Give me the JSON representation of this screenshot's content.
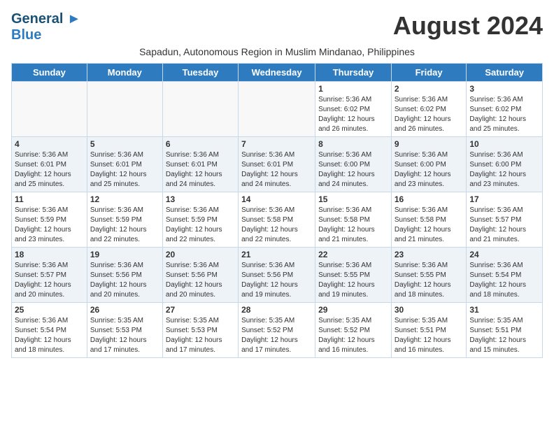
{
  "logo": {
    "line1": "General",
    "line2": "Blue"
  },
  "title": "August 2024",
  "subtitle": "Sapadun, Autonomous Region in Muslim Mindanao, Philippines",
  "weekdays": [
    "Sunday",
    "Monday",
    "Tuesday",
    "Wednesday",
    "Thursday",
    "Friday",
    "Saturday"
  ],
  "weeks": [
    [
      {
        "day": "",
        "info": ""
      },
      {
        "day": "",
        "info": ""
      },
      {
        "day": "",
        "info": ""
      },
      {
        "day": "",
        "info": ""
      },
      {
        "day": "1",
        "info": "Sunrise: 5:36 AM\nSunset: 6:02 PM\nDaylight: 12 hours\nand 26 minutes."
      },
      {
        "day": "2",
        "info": "Sunrise: 5:36 AM\nSunset: 6:02 PM\nDaylight: 12 hours\nand 26 minutes."
      },
      {
        "day": "3",
        "info": "Sunrise: 5:36 AM\nSunset: 6:02 PM\nDaylight: 12 hours\nand 25 minutes."
      }
    ],
    [
      {
        "day": "4",
        "info": "Sunrise: 5:36 AM\nSunset: 6:01 PM\nDaylight: 12 hours\nand 25 minutes."
      },
      {
        "day": "5",
        "info": "Sunrise: 5:36 AM\nSunset: 6:01 PM\nDaylight: 12 hours\nand 25 minutes."
      },
      {
        "day": "6",
        "info": "Sunrise: 5:36 AM\nSunset: 6:01 PM\nDaylight: 12 hours\nand 24 minutes."
      },
      {
        "day": "7",
        "info": "Sunrise: 5:36 AM\nSunset: 6:01 PM\nDaylight: 12 hours\nand 24 minutes."
      },
      {
        "day": "8",
        "info": "Sunrise: 5:36 AM\nSunset: 6:00 PM\nDaylight: 12 hours\nand 24 minutes."
      },
      {
        "day": "9",
        "info": "Sunrise: 5:36 AM\nSunset: 6:00 PM\nDaylight: 12 hours\nand 23 minutes."
      },
      {
        "day": "10",
        "info": "Sunrise: 5:36 AM\nSunset: 6:00 PM\nDaylight: 12 hours\nand 23 minutes."
      }
    ],
    [
      {
        "day": "11",
        "info": "Sunrise: 5:36 AM\nSunset: 5:59 PM\nDaylight: 12 hours\nand 23 minutes."
      },
      {
        "day": "12",
        "info": "Sunrise: 5:36 AM\nSunset: 5:59 PM\nDaylight: 12 hours\nand 22 minutes."
      },
      {
        "day": "13",
        "info": "Sunrise: 5:36 AM\nSunset: 5:59 PM\nDaylight: 12 hours\nand 22 minutes."
      },
      {
        "day": "14",
        "info": "Sunrise: 5:36 AM\nSunset: 5:58 PM\nDaylight: 12 hours\nand 22 minutes."
      },
      {
        "day": "15",
        "info": "Sunrise: 5:36 AM\nSunset: 5:58 PM\nDaylight: 12 hours\nand 21 minutes."
      },
      {
        "day": "16",
        "info": "Sunrise: 5:36 AM\nSunset: 5:58 PM\nDaylight: 12 hours\nand 21 minutes."
      },
      {
        "day": "17",
        "info": "Sunrise: 5:36 AM\nSunset: 5:57 PM\nDaylight: 12 hours\nand 21 minutes."
      }
    ],
    [
      {
        "day": "18",
        "info": "Sunrise: 5:36 AM\nSunset: 5:57 PM\nDaylight: 12 hours\nand 20 minutes."
      },
      {
        "day": "19",
        "info": "Sunrise: 5:36 AM\nSunset: 5:56 PM\nDaylight: 12 hours\nand 20 minutes."
      },
      {
        "day": "20",
        "info": "Sunrise: 5:36 AM\nSunset: 5:56 PM\nDaylight: 12 hours\nand 20 minutes."
      },
      {
        "day": "21",
        "info": "Sunrise: 5:36 AM\nSunset: 5:56 PM\nDaylight: 12 hours\nand 19 minutes."
      },
      {
        "day": "22",
        "info": "Sunrise: 5:36 AM\nSunset: 5:55 PM\nDaylight: 12 hours\nand 19 minutes."
      },
      {
        "day": "23",
        "info": "Sunrise: 5:36 AM\nSunset: 5:55 PM\nDaylight: 12 hours\nand 18 minutes."
      },
      {
        "day": "24",
        "info": "Sunrise: 5:36 AM\nSunset: 5:54 PM\nDaylight: 12 hours\nand 18 minutes."
      }
    ],
    [
      {
        "day": "25",
        "info": "Sunrise: 5:36 AM\nSunset: 5:54 PM\nDaylight: 12 hours\nand 18 minutes."
      },
      {
        "day": "26",
        "info": "Sunrise: 5:35 AM\nSunset: 5:53 PM\nDaylight: 12 hours\nand 17 minutes."
      },
      {
        "day": "27",
        "info": "Sunrise: 5:35 AM\nSunset: 5:53 PM\nDaylight: 12 hours\nand 17 minutes."
      },
      {
        "day": "28",
        "info": "Sunrise: 5:35 AM\nSunset: 5:52 PM\nDaylight: 12 hours\nand 17 minutes."
      },
      {
        "day": "29",
        "info": "Sunrise: 5:35 AM\nSunset: 5:52 PM\nDaylight: 12 hours\nand 16 minutes."
      },
      {
        "day": "30",
        "info": "Sunrise: 5:35 AM\nSunset: 5:51 PM\nDaylight: 12 hours\nand 16 minutes."
      },
      {
        "day": "31",
        "info": "Sunrise: 5:35 AM\nSunset: 5:51 PM\nDaylight: 12 hours\nand 15 minutes."
      }
    ]
  ]
}
